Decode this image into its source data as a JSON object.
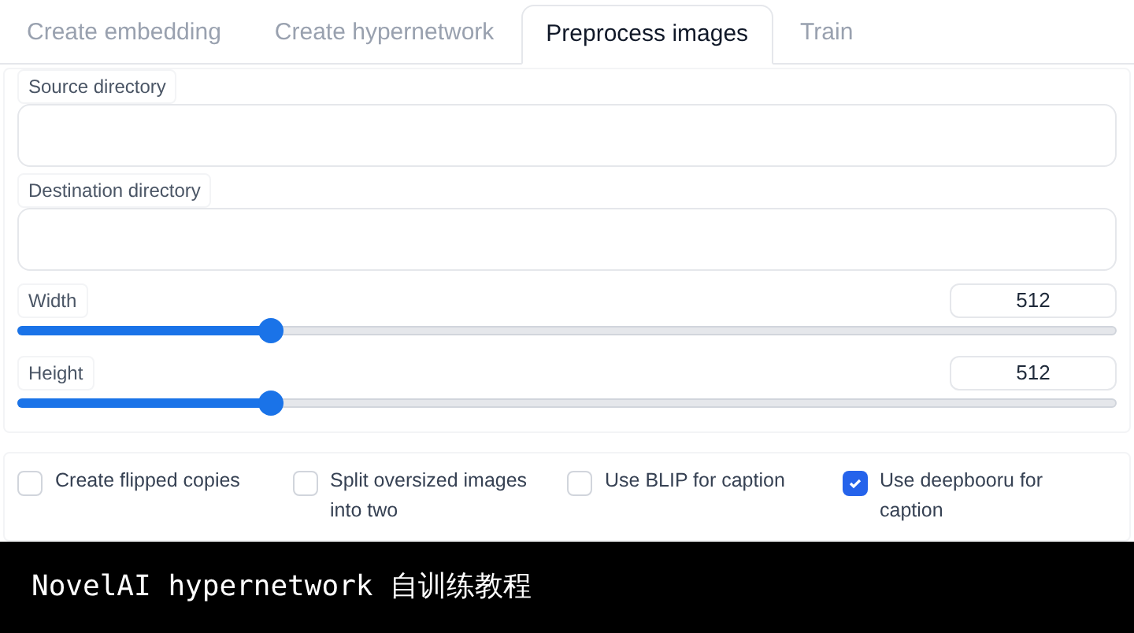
{
  "tabs": [
    {
      "label": "Create embedding",
      "selected": false
    },
    {
      "label": "Create hypernetwork",
      "selected": false
    },
    {
      "label": "Preprocess images",
      "selected": true
    },
    {
      "label": "Train",
      "selected": false
    }
  ],
  "fields": [
    {
      "label": "Source directory"
    },
    {
      "label": "Destination directory"
    }
  ],
  "sliders": [
    {
      "label": "Width",
      "value": "512",
      "level": 0.23
    },
    {
      "label": "Height",
      "value": "512",
      "level": 0.23
    }
  ],
  "checkboxes": [
    {
      "label": "Create flipped copies",
      "checked": false
    },
    {
      "label": "Split oversized images into two",
      "checked": false
    },
    {
      "label": "Use BLIP for caption",
      "checked": false
    },
    {
      "label": "Use deepbooru for caption",
      "checked": true
    }
  ],
  "caption": "NovelAI hypernetwork 自训练教程"
}
